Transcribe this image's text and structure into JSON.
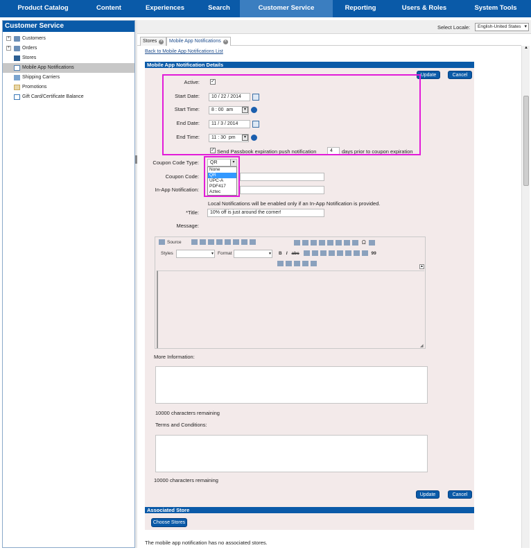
{
  "top_nav": [
    {
      "label": "Product Catalog"
    },
    {
      "label": "Content"
    },
    {
      "label": "Experiences"
    },
    {
      "label": "Search"
    },
    {
      "label": "Customer Service",
      "active": true
    },
    {
      "label": "Reporting"
    },
    {
      "label": "Users & Roles"
    },
    {
      "label": "System Tools"
    }
  ],
  "sidebar": {
    "title": "Customer Service",
    "items": [
      {
        "label": "Customers",
        "icon": "folder-icon",
        "expandable": true
      },
      {
        "label": "Orders",
        "icon": "folder-icon",
        "expandable": true
      },
      {
        "label": "Stores",
        "icon": "store-icon"
      },
      {
        "label": "Mobile App Notifications",
        "icon": "notification-icon",
        "selected": true
      },
      {
        "label": "Shipping Carriers",
        "icon": "truck-icon"
      },
      {
        "label": "Promotions",
        "icon": "promotion-icon"
      },
      {
        "label": "Gift Card/Certificate Balance",
        "icon": "gift-card-icon"
      }
    ]
  },
  "locale": {
    "label": "Select Locale:",
    "value": "English-United States"
  },
  "tabs": [
    {
      "label": "Stores"
    },
    {
      "label": "Mobile App Notifications"
    }
  ],
  "back_link": "Back to Mobile App Notifications List",
  "form": {
    "section_title": "Mobile App Notification Details",
    "update_label": "Update",
    "cancel_label": "Cancel",
    "active_label": "Active:",
    "active_checked": "✓",
    "start_date_label": "Start Date:",
    "start_date": {
      "m": "10",
      "d": "22",
      "y": "2014"
    },
    "start_time_label": "Start Time:",
    "start_time": {
      "h": "8",
      "m": "00",
      "ampm": "am"
    },
    "end_date_label": "End Date:",
    "end_date": {
      "m": "11",
      "d": "3",
      "y": "2014"
    },
    "end_time_label": "End Time:",
    "end_time": {
      "h": "11",
      "m": "30",
      "ampm": "pm"
    },
    "passbook_prefix": "Send Passbook expiration push notification",
    "passbook_days": "4",
    "passbook_suffix": "days prior to coupon expiration",
    "coupon_type_label": "Coupon Code Type:",
    "coupon_type_value": "QR",
    "coupon_type_options": [
      "None",
      "QR",
      "UPC-A",
      "PDF417",
      "Aztec"
    ],
    "coupon_code_label": "Coupon Code:",
    "inapp_label": "In-App Notification:",
    "local_note": "Local Notifications will be enabled only if an In-App Notification is provided.",
    "title_label": "*Title:",
    "title_value": "10% off is just around the corner!",
    "message_label": "Message:",
    "editor": {
      "source": "Source",
      "styles": "Styles",
      "format": "Format",
      "omega": "Ω",
      "quote": "99"
    },
    "more_info_label": "More Information:",
    "chars_remaining_1": "10000 characters remaining",
    "terms_label": "Terms and Conditions:",
    "chars_remaining_2": "10000 characters remaining",
    "associated_title": "Associated Store",
    "choose_stores": "Choose Stores",
    "no_stores": "The mobile app notification has no associated stores."
  }
}
